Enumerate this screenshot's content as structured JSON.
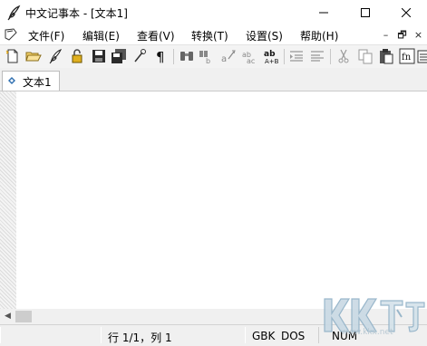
{
  "window": {
    "title": "中文记事本 - [文本1]",
    "controls": {
      "minimize": "minimize",
      "maximize": "maximize",
      "close": "close"
    }
  },
  "menubar": {
    "items": [
      {
        "label": "文件(F)"
      },
      {
        "label": "编辑(E)"
      },
      {
        "label": "查看(V)"
      },
      {
        "label": "转换(T)"
      },
      {
        "label": "设置(S)"
      },
      {
        "label": "帮助(H)"
      }
    ],
    "mdi": {
      "minimize": "–",
      "restore": "🗗",
      "close": "×"
    }
  },
  "toolbar": {
    "buttons": [
      "new-file-icon",
      "open-folder-icon",
      "app-feather-icon",
      "lock-icon",
      "save-icon",
      "save-all-icon",
      "find-tool-icon",
      "pilcrow-icon",
      "binoculars-icon",
      "find-replace-icon",
      "replace-icon",
      "abc-icon",
      "ab-convert-icon",
      "indent-icon",
      "outdent-icon",
      "cut-icon",
      "copy-icon",
      "paste-icon",
      "font-icon",
      "properties-icon"
    ]
  },
  "tabs": [
    {
      "label": "文本1",
      "active": true
    }
  ],
  "editor": {
    "content": ""
  },
  "statusbar": {
    "position": "行 1/1，列 1",
    "encoding": "GBK",
    "line_ending": "DOS",
    "numlock": "NUM"
  },
  "watermark": {
    "text": "KK下载",
    "url": "www.kkx.net"
  },
  "colors": {
    "accent": "#2f6fb0",
    "watermark": "#9db9cc"
  }
}
